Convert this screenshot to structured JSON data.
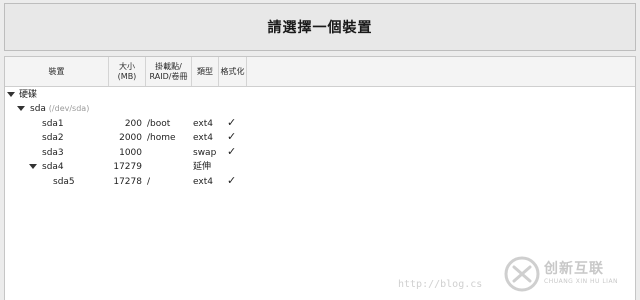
{
  "banner": {
    "title": "請選擇一個裝置"
  },
  "columns": {
    "device": "裝置",
    "size_line1": "大小",
    "size_line2": "(MB)",
    "mount_line1": "掛載點/",
    "mount_line2": "RAID/卷冊",
    "type": "類型",
    "format": "格式化"
  },
  "tree": {
    "group_label": "硬碟",
    "disk_name": "sda",
    "disk_path": "(/dev/sda)",
    "rows": [
      {
        "device": "sda1",
        "size": "200",
        "mount": "/boot",
        "type": "ext4",
        "format": "✓"
      },
      {
        "device": "sda2",
        "size": "2000",
        "mount": "/home",
        "type": "ext4",
        "format": "✓"
      },
      {
        "device": "sda3",
        "size": "1000",
        "mount": "",
        "type": "swap",
        "format": "✓"
      },
      {
        "device": "sda4",
        "size": "17279",
        "mount": "",
        "type": "延伸",
        "format": ""
      },
      {
        "device": "sda5",
        "size": "17278",
        "mount": "/",
        "type": "ext4",
        "format": "✓"
      }
    ]
  },
  "watermark": {
    "url": "http://blog.cs"
  },
  "logo": {
    "name": "创新互联",
    "sub": "CHUANG XIN HU LIAN"
  }
}
